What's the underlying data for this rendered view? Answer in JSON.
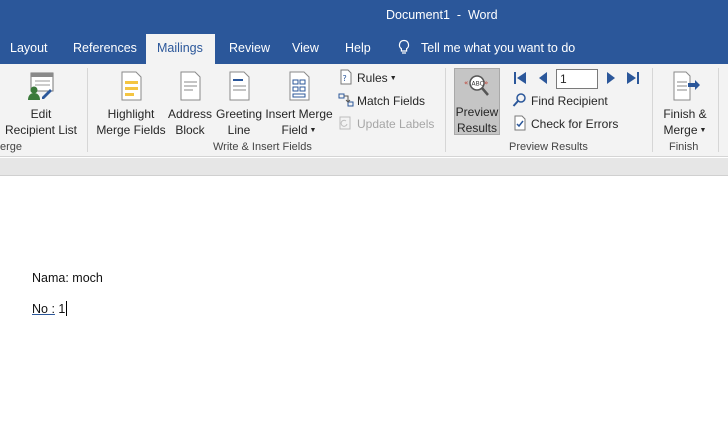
{
  "window": {
    "title": "Document1  -  Word"
  },
  "tabs": [
    {
      "label": "Layout"
    },
    {
      "label": "References"
    },
    {
      "label": "Mailings"
    },
    {
      "label": "Review"
    },
    {
      "label": "View"
    },
    {
      "label": "Help"
    }
  ],
  "tell_me": {
    "label": "Tell me what you want to do",
    "icon": "lightbulb-icon"
  },
  "ribbon": {
    "start_group": {
      "edit_recipient_line1": "Edit",
      "edit_recipient_line2": "Recipient List",
      "label": "erge"
    },
    "write_insert": {
      "label": "Write & Insert Fields",
      "highlight_line1": "Highlight",
      "highlight_line2": "Merge Fields",
      "address_line1": "Address",
      "address_line2": "Block",
      "greeting_line1": "Greeting",
      "greeting_line2": "Line",
      "insert_line1": "Insert Merge",
      "insert_line2": "Field",
      "rules": "Rules",
      "match_fields": "Match Fields",
      "update_labels": "Update Labels"
    },
    "preview_results": {
      "label": "Preview Results",
      "preview_line1": "Preview",
      "preview_line2": "Results",
      "record_value": "1",
      "find_recipient": "Find Recipient",
      "check_errors": "Check for Errors"
    },
    "finish": {
      "label": "Finish",
      "finish_line1": "Finish &",
      "finish_line2": "Merge"
    }
  },
  "document": {
    "line1": "Nama: moch",
    "line2_field": "No :",
    "line2_value": " 1"
  },
  "colors": {
    "accent": "#2b579a",
    "ribbon_bg": "#f3f3f3",
    "active_toggle": "#c5c5c5"
  }
}
